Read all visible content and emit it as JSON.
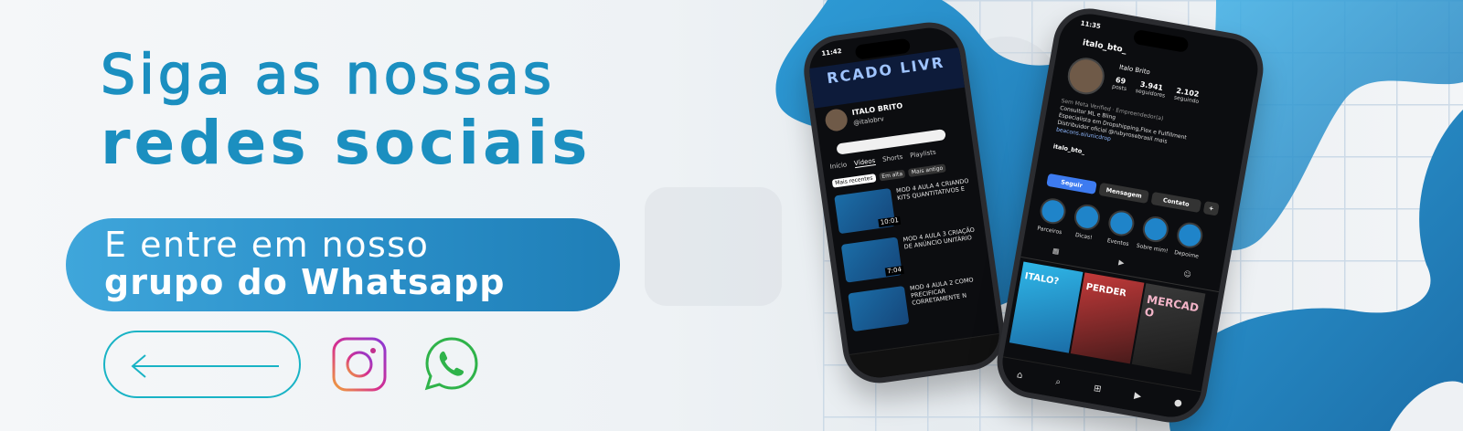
{
  "headline": {
    "line1": "Siga as nossas",
    "line2": "redes sociais"
  },
  "cta": {
    "line1": "E entre em nosso",
    "line2": "grupo do Whatsapp"
  },
  "colors": {
    "brand_blue": "#1b8fc0",
    "pill_gradient_start": "#3fa6db",
    "pill_gradient_end": "#1f7eb7",
    "arrow_teal": "#19b3c5",
    "instagram_pink": "#d62e8f",
    "whatsapp_green": "#2fb34a"
  },
  "icons": {
    "arrow": "arrow-left-icon",
    "instagram": "instagram-icon",
    "whatsapp": "whatsapp-icon"
  },
  "youtube_phone": {
    "time": "11:42",
    "banner_text": "RCADO LIVR",
    "channel_name": "ITALO BRITO",
    "handle": "@italobrv",
    "tabs": [
      "Início",
      "Vídeos",
      "Shorts",
      "Playlists"
    ],
    "filters": [
      "Mais recentes",
      "Em alta",
      "Mais antigo"
    ],
    "videos": [
      {
        "title": "MOD 4 AULA 4 CRIANDO KITS QUANTITATIVOS E",
        "duration": "10:01"
      },
      {
        "title": "MOD 4 AULA 3 CRIAÇÃO DE ANÚNCIO UNITÁRIO",
        "duration": "7:04"
      },
      {
        "title": "MOD 4 AULA 2 COMO PRECIFICAR CORRETAMENTE N",
        "duration": ""
      }
    ]
  },
  "instagram_phone": {
    "time": "11:35",
    "username": "italo_bto_",
    "display_name": "Italo Brito",
    "stats": [
      {
        "value": "69",
        "label": "posts"
      },
      {
        "value": "3.941",
        "label": "seguidores"
      },
      {
        "value": "2.102",
        "label": "seguindo"
      }
    ],
    "bio": [
      "Sem Meta Verified · Empreendedor(a)",
      "Consultor ML e Bling",
      "Especialista em Dropshipping,Flex e Fulfillment",
      "Distribuidor oficial @rubyrosebrasil mais",
      "beacons.ai/unicdrop"
    ],
    "threads_handle": "italo_bto_",
    "buttons": [
      "Seguir",
      "Mensagem",
      "Contato"
    ],
    "highlights": [
      "Parceiros",
      "Dicas!",
      "Eventos",
      "Sobre mim!",
      "Depoime"
    ],
    "tiles": [
      "ITALO?",
      "PERDER",
      "MERCADO"
    ]
  }
}
